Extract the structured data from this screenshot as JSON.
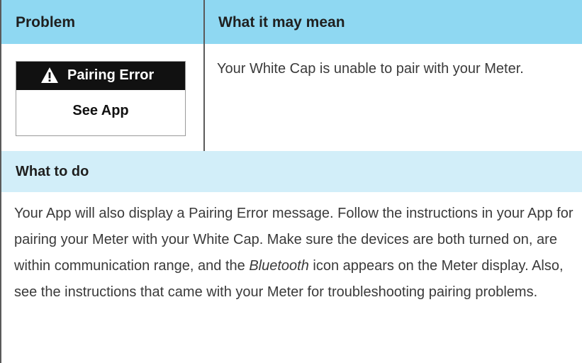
{
  "table": {
    "header": {
      "problem": "Problem",
      "meaning": "What it may mean"
    },
    "meter_display": {
      "icon": "warning-triangle-icon",
      "banner_text": "Pairing Error",
      "sub_text": "See App"
    },
    "meaning_text": "Your White Cap is unable to pair with your Meter.",
    "todo": {
      "title": "What to do",
      "text_before": "Your App will also display a Pairing Error message. Follow the instructions in your App for pairing your Meter with your White Cap. Make sure the devices are both turned on, are within communication range, and the ",
      "italic_word": "Bluetooth",
      "text_after": " icon appears on the Meter display. Also, see the instructions that came with your Meter for troubleshooting pairing problems."
    }
  },
  "colors": {
    "header_bg": "#8fd8f2",
    "subheader_bg": "#d2eef9",
    "banner_bg": "#111111"
  }
}
